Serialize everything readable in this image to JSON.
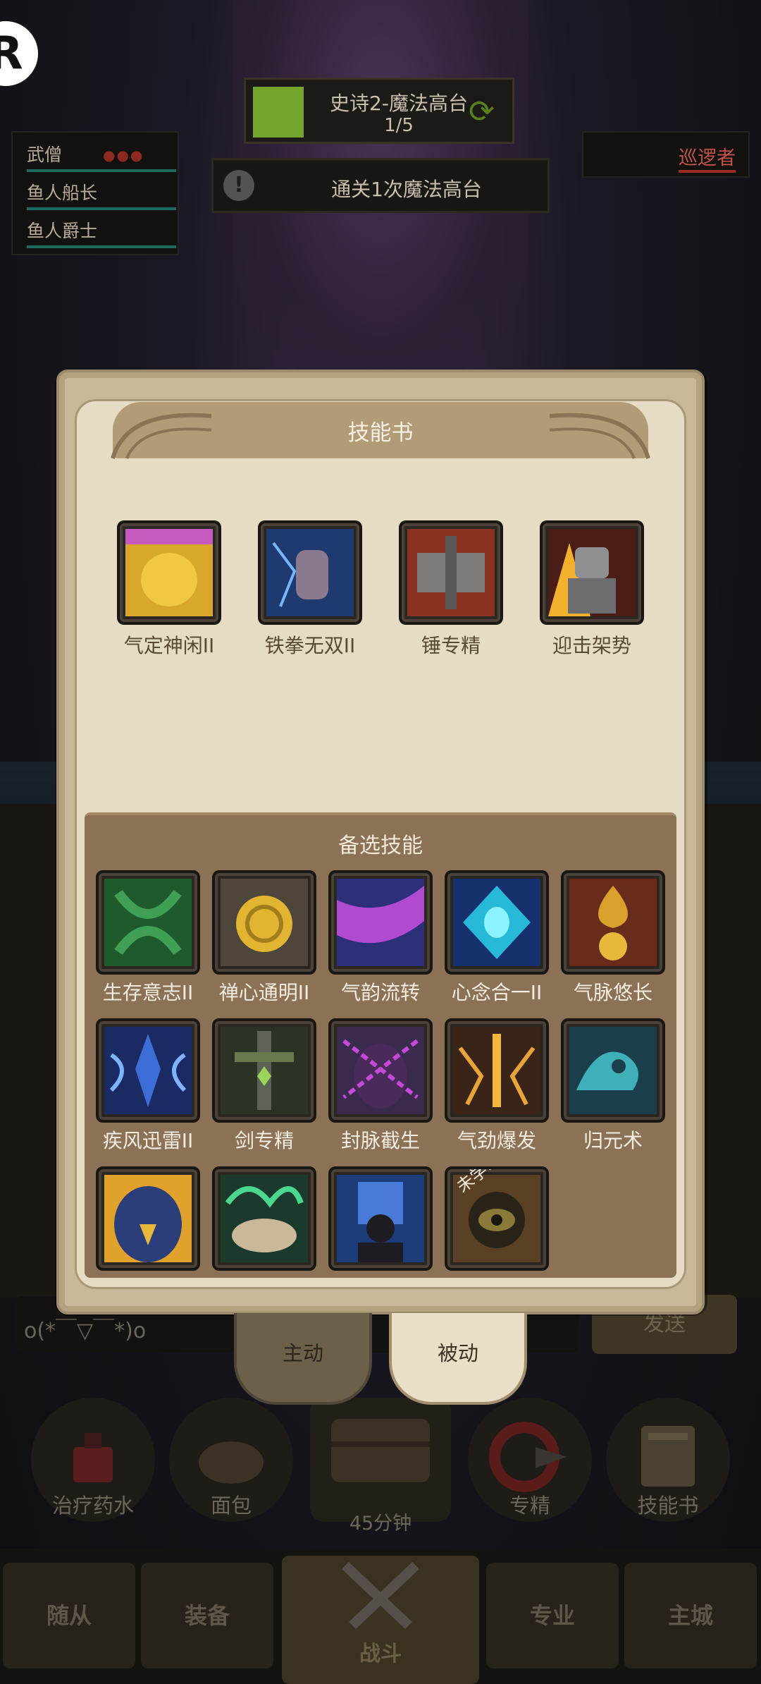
{
  "header": {
    "stage_title": "史诗2-魔法高台",
    "stage_progress": "1/5",
    "quest_text": "通关1次魔法高台",
    "quest_icon": "!"
  },
  "party": {
    "members": [
      "武僧",
      "鱼人船长",
      "鱼人爵士"
    ],
    "leader_status": "●●●"
  },
  "enemy": {
    "name": "巡逻者"
  },
  "modal": {
    "title": "技能书",
    "alt_title": "备选技能",
    "equipped": [
      {
        "label": "气定神闲II",
        "icon": "golden-torso-icon"
      },
      {
        "label": "铁拳无双II",
        "icon": "iron-fist-icon"
      },
      {
        "label": "锤专精",
        "icon": "hammer-mastery-icon"
      },
      {
        "label": "迎击架势",
        "icon": "armored-stance-icon"
      }
    ],
    "alternates": [
      {
        "label": "生存意志II",
        "icon": "vine-knot-icon"
      },
      {
        "label": "禅心通明II",
        "icon": "golden-spiral-icon"
      },
      {
        "label": "气韵流转",
        "icon": "purple-flow-icon"
      },
      {
        "label": "心念合一II",
        "icon": "cyan-gem-icon"
      },
      {
        "label": "气脉悠长",
        "icon": "golden-bloom-icon"
      },
      {
        "label": "疾风迅雷II",
        "icon": "blue-lightning-icon"
      },
      {
        "label": "剑专精",
        "icon": "sword-mastery-icon"
      },
      {
        "label": "封脉截生",
        "icon": "chained-figure-icon"
      },
      {
        "label": "气劲爆发",
        "icon": "golden-burst-icon"
      },
      {
        "label": "归元术",
        "icon": "teal-wave-icon"
      },
      {
        "label": "",
        "icon": "eagle-icon"
      },
      {
        "label": "",
        "icon": "green-flame-fist-icon"
      },
      {
        "label": "",
        "icon": "blue-spirit-icon"
      },
      {
        "label": "",
        "icon": "bronze-eye-icon",
        "badge": "未学习"
      }
    ],
    "tabs": {
      "active": "主动",
      "passive": "被动"
    }
  },
  "chat": {
    "text": "o(*￣▽￣*)o",
    "send": "发送"
  },
  "quick_items": [
    {
      "label": "治疗药水",
      "icon": "potion-icon"
    },
    {
      "label": "面包",
      "icon": "bread-icon"
    },
    {
      "label": "",
      "icon": "chest-icon"
    },
    {
      "label": "专精",
      "icon": "mastery-icon"
    },
    {
      "label": "技能书",
      "icon": "skill-book-icon"
    }
  ],
  "chest_timer": "45分钟",
  "nav": {
    "followers": "随从",
    "equipment": "装备",
    "battle": "战斗",
    "profession": "专业",
    "main_city": "主城"
  },
  "colors": {
    "parchment": "#e6dcc3",
    "panel_brown": "#8b7257",
    "stage_green": "#74a62e",
    "enemy_red": "#c2534a"
  }
}
